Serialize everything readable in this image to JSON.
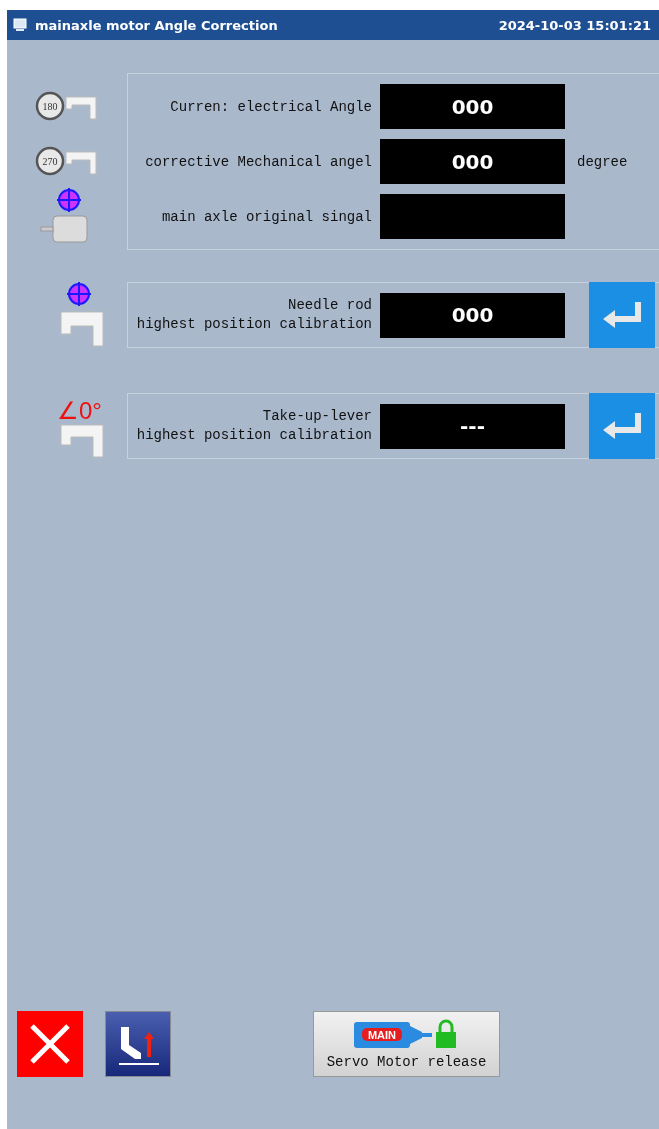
{
  "window": {
    "title": "mainaxle motor Angle Correction",
    "datetime": "2024-10-03 15:01:21"
  },
  "readings": [
    {
      "kind": "dial",
      "dial": "180",
      "label": "Curren: electrical Angle",
      "value": "000"
    },
    {
      "kind": "dial",
      "dial": "270",
      "label": "corrective Mechanical angel",
      "value": "000",
      "unit": "degree"
    },
    {
      "kind": "motor",
      "label": "main axle original singal"
    }
  ],
  "calibrations": [
    {
      "kind": "target",
      "label_lines": [
        "Needle rod",
        "highest position calibration"
      ],
      "value": "000"
    },
    {
      "kind": "angle",
      "icon_text": "∠0°",
      "label_lines": [
        "Take-up-lever",
        "highest position calibration"
      ],
      "value": "---"
    }
  ],
  "buttons": [
    {
      "kind": "cancel"
    },
    {
      "kind": "presser"
    },
    {
      "kind": "release",
      "badge": "MAIN",
      "label": "Servo Motor release"
    }
  ]
}
